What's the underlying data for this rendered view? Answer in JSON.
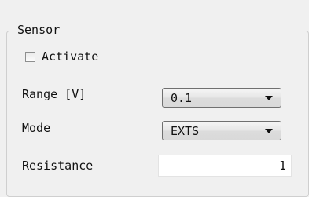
{
  "group": {
    "title": "Sensor"
  },
  "activate": {
    "label": "Activate",
    "checked": false
  },
  "range": {
    "label": "Range [V]",
    "value": "0.1"
  },
  "mode": {
    "label": "Mode",
    "value": "EXTS"
  },
  "resistance": {
    "label": "Resistance",
    "value": "1"
  },
  "icons": {
    "dropdown": "chevron-down-icon",
    "checkbox": "checkbox-unchecked"
  }
}
